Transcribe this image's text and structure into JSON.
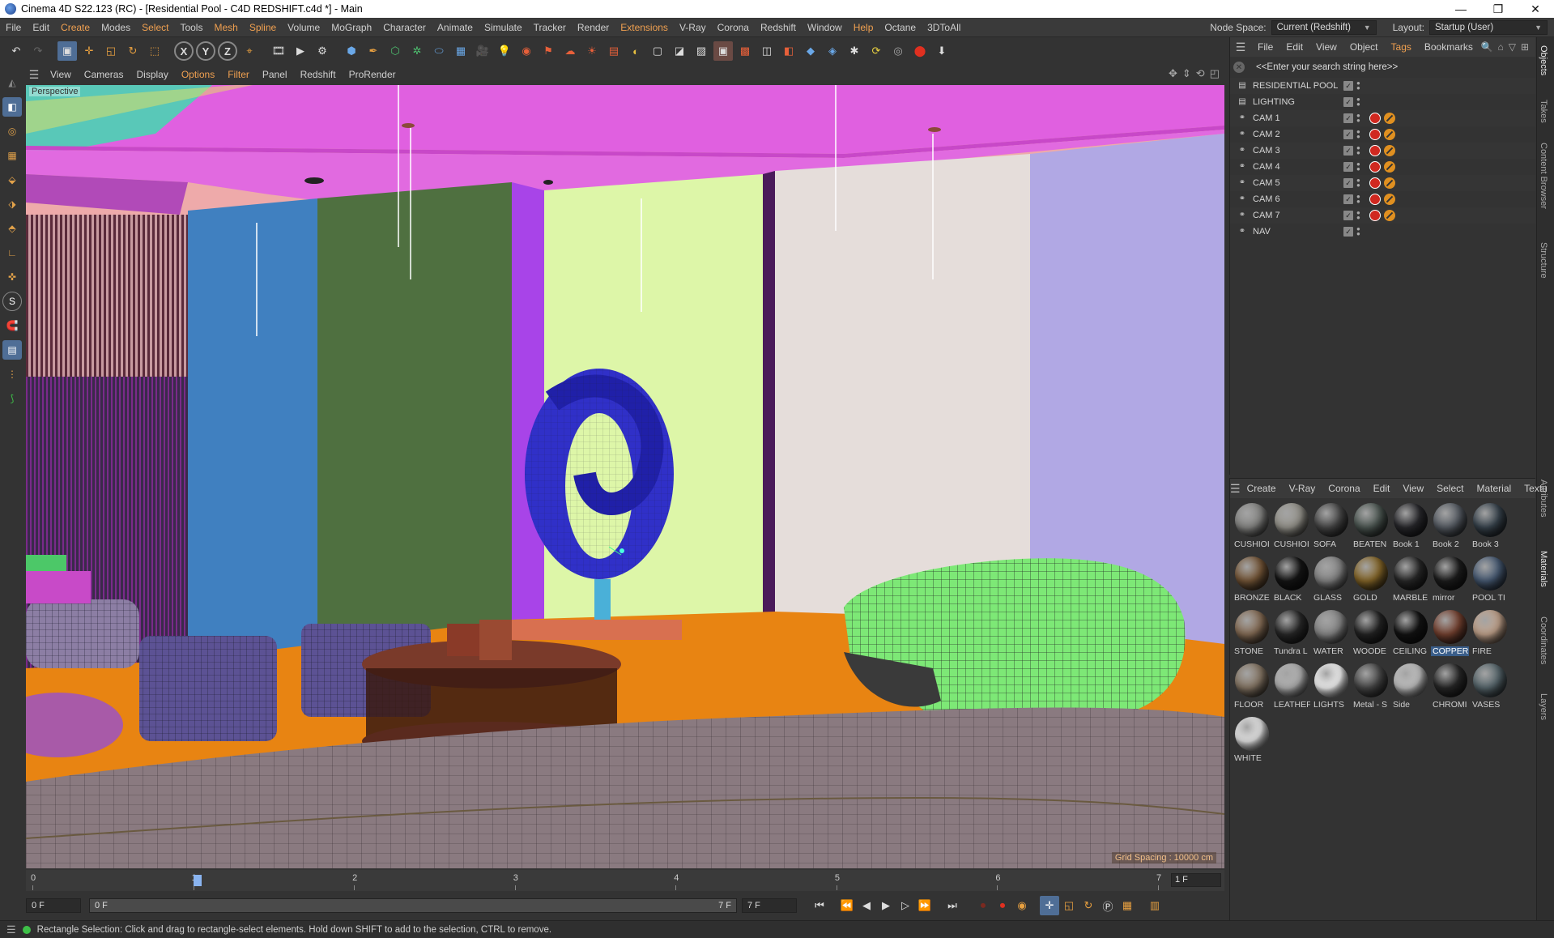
{
  "window": {
    "title": "Cinema 4D S22.123 (RC) - [Residential Pool - C4D REDSHIFT.c4d *] - Main",
    "controls": [
      "—",
      "❐",
      "✕"
    ]
  },
  "menubar": {
    "items": [
      {
        "label": "File",
        "hl": false
      },
      {
        "label": "Edit",
        "hl": false
      },
      {
        "label": "Create",
        "hl": true
      },
      {
        "label": "Modes",
        "hl": false
      },
      {
        "label": "Select",
        "hl": true
      },
      {
        "label": "Tools",
        "hl": false
      },
      {
        "label": "Mesh",
        "hl": true
      },
      {
        "label": "Spline",
        "hl": true
      },
      {
        "label": "Volume",
        "hl": false
      },
      {
        "label": "MoGraph",
        "hl": false
      },
      {
        "label": "Character",
        "hl": false
      },
      {
        "label": "Animate",
        "hl": false
      },
      {
        "label": "Simulate",
        "hl": false
      },
      {
        "label": "Tracker",
        "hl": false
      },
      {
        "label": "Render",
        "hl": false
      },
      {
        "label": "Extensions",
        "hl": true
      },
      {
        "label": "V-Ray",
        "hl": false
      },
      {
        "label": "Corona",
        "hl": false
      },
      {
        "label": "Redshift",
        "hl": false
      },
      {
        "label": "Window",
        "hl": false
      },
      {
        "label": "Help",
        "hl": true
      },
      {
        "label": "Octane",
        "hl": false
      },
      {
        "label": "3DToAll",
        "hl": false
      }
    ],
    "node_space_label": "Node Space:",
    "node_space_value": "Current (Redshift)",
    "layout_label": "Layout:",
    "layout_value": "Startup (User)"
  },
  "viewport_menu": {
    "items": [
      {
        "label": "View",
        "hl": false
      },
      {
        "label": "Cameras",
        "hl": false
      },
      {
        "label": "Display",
        "hl": false
      },
      {
        "label": "Options",
        "hl": true
      },
      {
        "label": "Filter",
        "hl": true
      },
      {
        "label": "Panel",
        "hl": false
      },
      {
        "label": "Redshift",
        "hl": false
      },
      {
        "label": "ProRender",
        "hl": false
      }
    ]
  },
  "viewport": {
    "camera_label": "Perspective",
    "grid_spacing": "Grid Spacing : 10000 cm"
  },
  "timeline": {
    "ticks": [
      "0",
      "1",
      "2",
      "3",
      "4",
      "5",
      "6",
      "7"
    ],
    "end_field": "1 F"
  },
  "transport": {
    "current_frame": "0 F",
    "range_start": "0 F",
    "range_end": "7 F",
    "max_frame": "7 F"
  },
  "status": {
    "text": "Rectangle Selection: Click and drag to rectangle-select elements. Hold down SHIFT to add to the selection, CTRL to remove."
  },
  "object_manager": {
    "menu": [
      {
        "label": "File",
        "hl": false
      },
      {
        "label": "Edit",
        "hl": false
      },
      {
        "label": "View",
        "hl": false
      },
      {
        "label": "Object",
        "hl": false
      },
      {
        "label": "Tags",
        "hl": true
      },
      {
        "label": "Bookmarks",
        "hl": false
      }
    ],
    "search_placeholder": "<<Enter your search string here>>",
    "objects": [
      {
        "name": "RESIDENTIAL POOL",
        "icon": "layer-icon",
        "tags": false
      },
      {
        "name": "LIGHTING",
        "icon": "layer-icon",
        "tags": false
      },
      {
        "name": "CAM 1",
        "icon": "camera-icon",
        "tags": true
      },
      {
        "name": "CAM 2",
        "icon": "camera-icon",
        "tags": true
      },
      {
        "name": "CAM 3",
        "icon": "camera-icon",
        "tags": true
      },
      {
        "name": "CAM 4",
        "icon": "camera-icon",
        "tags": true
      },
      {
        "name": "CAM 5",
        "icon": "camera-icon",
        "tags": true
      },
      {
        "name": "CAM 6",
        "icon": "camera-icon",
        "tags": true
      },
      {
        "name": "CAM 7",
        "icon": "camera-icon",
        "tags": true
      },
      {
        "name": "NAV",
        "icon": "camera-icon",
        "tags": false
      }
    ]
  },
  "side_tabs": {
    "top": [
      "Objects",
      "Takes",
      "Content Browser",
      "Structure"
    ],
    "bottom": [
      "Attributes",
      "Materials",
      "Coordinates",
      "Layers"
    ]
  },
  "material_manager": {
    "menu": [
      "Create",
      "V-Ray",
      "Corona",
      "Edit",
      "View",
      "Select",
      "Material",
      "Textu"
    ],
    "materials": [
      {
        "name": "CUSHIOI",
        "color": "#8a8a88"
      },
      {
        "name": "CUSHIOI",
        "color": "#9a9890"
      },
      {
        "name": "SOFA",
        "color": "#4a4a4a"
      },
      {
        "name": "BEATEN",
        "color": "#4f5a55"
      },
      {
        "name": "Book 1",
        "color": "#2a2a2e"
      },
      {
        "name": "Book 2",
        "color": "#5a6068"
      },
      {
        "name": "Book 3",
        "color": "#3a4650"
      },
      {
        "name": "BRONZE",
        "color": "#7a5a3a"
      },
      {
        "name": "BLACK",
        "color": "#161616"
      },
      {
        "name": "GLASS",
        "color": "#8a8a8a"
      },
      {
        "name": "GOLD",
        "color": "#8a6a2a"
      },
      {
        "name": "MARBLE",
        "color": "#2a2a2a"
      },
      {
        "name": "mirror",
        "color": "#1e1e1e"
      },
      {
        "name": "POOL TI",
        "color": "#4a5e78"
      },
      {
        "name": "STONE",
        "color": "#8a7058"
      },
      {
        "name": "Tundra L",
        "color": "#2a2a2a"
      },
      {
        "name": "WATER",
        "color": "#8c8c8c"
      },
      {
        "name": "WOODE",
        "color": "#262626"
      },
      {
        "name": "CEILING",
        "color": "#141414"
      },
      {
        "name": "COPPER",
        "color": "#7a4432"
      },
      {
        "name": "FIRE",
        "color": "#c8a890"
      },
      {
        "name": "FLOOR",
        "color": "#8a7a68"
      },
      {
        "name": "LEATHEF",
        "color": "#b8b8b8"
      },
      {
        "name": "LIGHTS",
        "color": "#ffffff"
      },
      {
        "name": "Metal - S",
        "color": "#4a4a4a"
      },
      {
        "name": "Side",
        "color": "#c8c8c8"
      },
      {
        "name": "CHROMI",
        "color": "#2a2a2a"
      },
      {
        "name": "VASES",
        "color": "#5a6a70"
      },
      {
        "name": "WHITE",
        "color": "#f0f0f0"
      }
    ],
    "selected": "COPPER"
  }
}
